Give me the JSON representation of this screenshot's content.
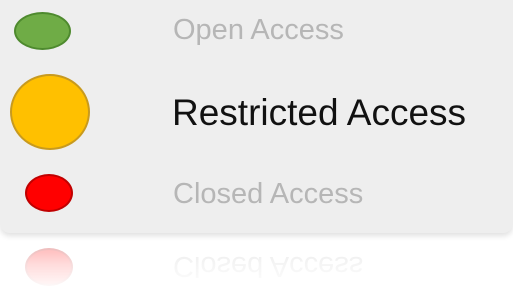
{
  "legend": {
    "items": [
      {
        "label": "Open Access",
        "color": "#6fac46",
        "border": "#4e8a2e",
        "state": "inactive"
      },
      {
        "label": "Restricted Access",
        "color": "#ffc000",
        "border": "#c89a1e",
        "state": "active"
      },
      {
        "label": "Closed Access",
        "color": "#ff0000",
        "border": "#c00000",
        "state": "inactive"
      }
    ]
  },
  "icons": {
    "open": "green-circle-icon",
    "restricted": "amber-circle-icon",
    "closed": "red-circle-icon"
  }
}
